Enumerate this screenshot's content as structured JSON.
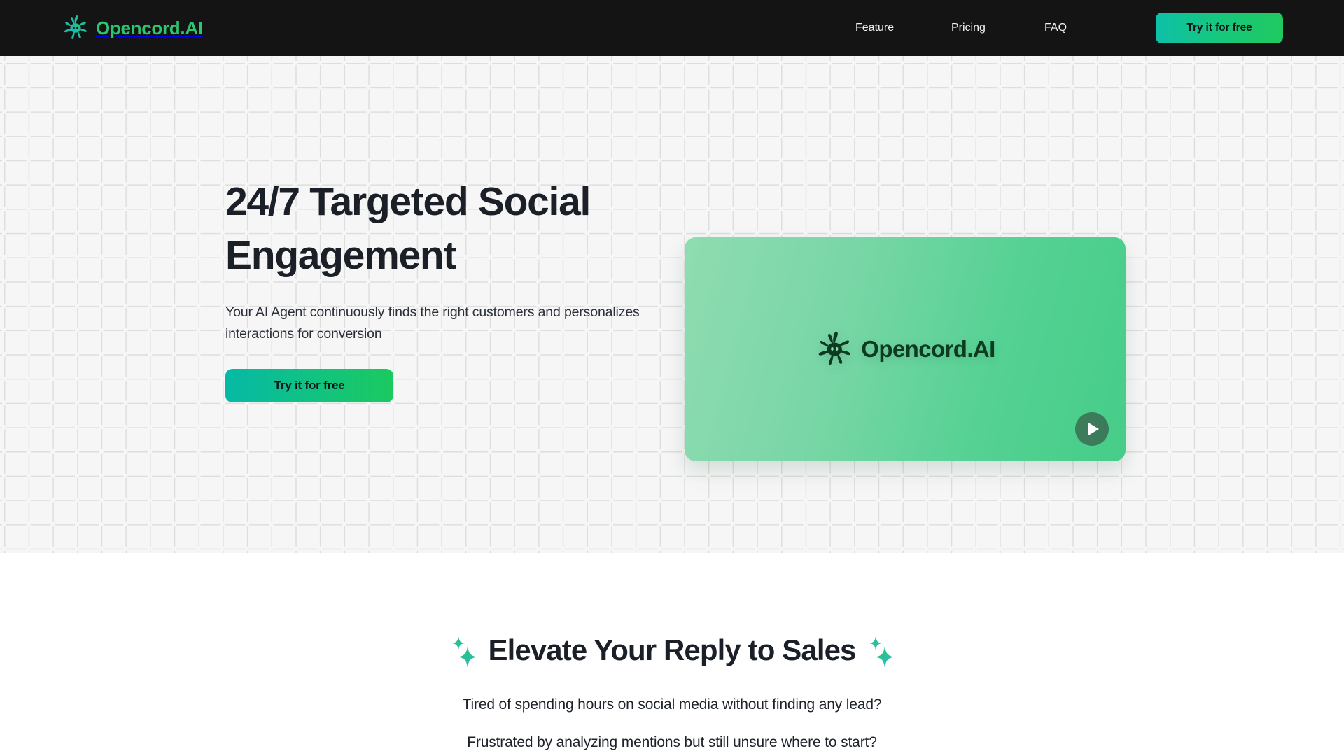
{
  "header": {
    "logo_icon": "opencord-swirl-icon",
    "brand": "Opencord.AI",
    "brand_color": "#29c76f",
    "background": "#141414",
    "nav": [
      {
        "label": "Feature"
      },
      {
        "label": "Pricing"
      },
      {
        "label": "FAQ"
      }
    ],
    "cta_label": "Try it for free",
    "cta_gradient": [
      "#0ec0a8",
      "#20c95f"
    ]
  },
  "hero": {
    "background": "#f6f6f6",
    "pattern": "plus-dot-grid",
    "title": "24/7 Targeted Social Engagement",
    "subtitle": "Your AI Agent continuously finds the right customers and personalizes interactions for conversion",
    "cta_label": "Try it for free",
    "cta_gradient": [
      "#05b9a6",
      "#1bc95e"
    ],
    "card": {
      "logo_icon": "opencord-swirl-icon",
      "logo_text": "Opencord.AI",
      "logo_text_color": "#0d3b22",
      "gradient": [
        "#8fdcb1",
        "#46cd88"
      ],
      "play_icon": "play-icon"
    }
  },
  "section2": {
    "sparkle_icon": "sparkles-icon",
    "title": "Elevate Your Reply to Sales",
    "lines": [
      "Tired of spending hours on social media without finding any lead?",
      "Frustrated by analyzing mentions but still unsure where to start?"
    ],
    "sparkle_colors": [
      "#20c96a",
      "#2fb6d8"
    ]
  }
}
